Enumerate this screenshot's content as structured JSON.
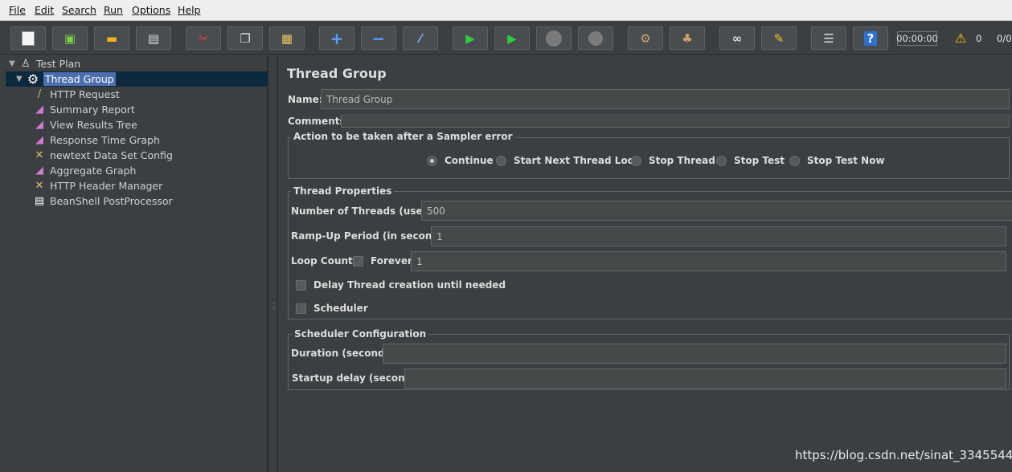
{
  "menu": [
    "File",
    "Edit",
    "Search",
    "Run",
    "Options",
    "Help"
  ],
  "toolbar": {
    "timer": "00:00:00",
    "warnings": "0",
    "threads": "0/0"
  },
  "tree": {
    "items": [
      {
        "label": "Test Plan",
        "icon": "test-plan-icon"
      },
      {
        "label": "Thread Group",
        "icon": "gear-icon"
      },
      {
        "label": "HTTP Request",
        "icon": "pipette-icon"
      },
      {
        "label": "Summary Report",
        "icon": "graph-icon"
      },
      {
        "label": "View Results Tree",
        "icon": "graph-icon"
      },
      {
        "label": "Response Time Graph",
        "icon": "graph-icon"
      },
      {
        "label": "newtext Data Set Config",
        "icon": "wrench-icon"
      },
      {
        "label": "Aggregate Graph",
        "icon": "graph-icon"
      },
      {
        "label": "HTTP Header Manager",
        "icon": "wrench-icon"
      },
      {
        "label": "BeanShell PostProcessor",
        "icon": "script-icon"
      }
    ]
  },
  "panel": {
    "title": "Thread Group",
    "name_label": "Name:",
    "name_value": "Thread Group",
    "comments_label": "Comments:",
    "sampler_error": {
      "legend": "Action to be taken after a Sampler error",
      "options": [
        "Continue",
        "Start Next Thread Loop",
        "Stop Thread",
        "Stop Test",
        "Stop Test Now"
      ],
      "selected": "Continue"
    },
    "thread_props": {
      "legend": "Thread Properties",
      "threads_label": "Number of Threads (users):",
      "threads_value": "500",
      "rampup_label": "Ramp-Up Period (in seconds):",
      "rampup_value": "1",
      "loop_label": "Loop Count:",
      "forever_label": "Forever",
      "loop_value": "1",
      "delay_label": "Delay Thread creation until needed",
      "scheduler_label": "Scheduler"
    },
    "scheduler_config": {
      "legend": "Scheduler Configuration",
      "duration_label": "Duration (seconds)",
      "startup_label": "Startup delay (seconds)"
    }
  },
  "watermark": "https://blog.csdn.net/sinat_33455447",
  "colors": {
    "background": "#3c3f41",
    "selection": "#4b6eaf",
    "field": "#45494a"
  }
}
